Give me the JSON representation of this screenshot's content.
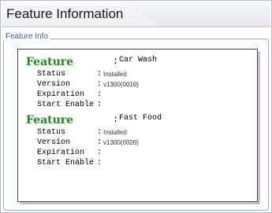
{
  "header": {
    "title": "Feature Information"
  },
  "section": {
    "legend": "Feature Info"
  },
  "features": [
    {
      "label": "Feature",
      "colon": ":",
      "name": "Car Wash",
      "attrs": [
        {
          "label": "Status",
          "colon": ":",
          "value": "Installed"
        },
        {
          "label": "Version",
          "colon": ":",
          "value": "v1300(0010)"
        },
        {
          "label": "Expiration",
          "colon": ":",
          "value": ""
        },
        {
          "label": "Start Enable",
          "colon": ":",
          "value": ""
        }
      ]
    },
    {
      "label": "Feature",
      "colon": ":",
      "name": "Fast Food",
      "attrs": [
        {
          "label": "Status",
          "colon": ":",
          "value": "Installed"
        },
        {
          "label": "Version",
          "colon": ":",
          "value": "v1300(0020)"
        },
        {
          "label": "Expiration",
          "colon": ":",
          "value": ""
        },
        {
          "label": "Start Enable",
          "colon": ":",
          "value": ""
        }
      ]
    }
  ]
}
